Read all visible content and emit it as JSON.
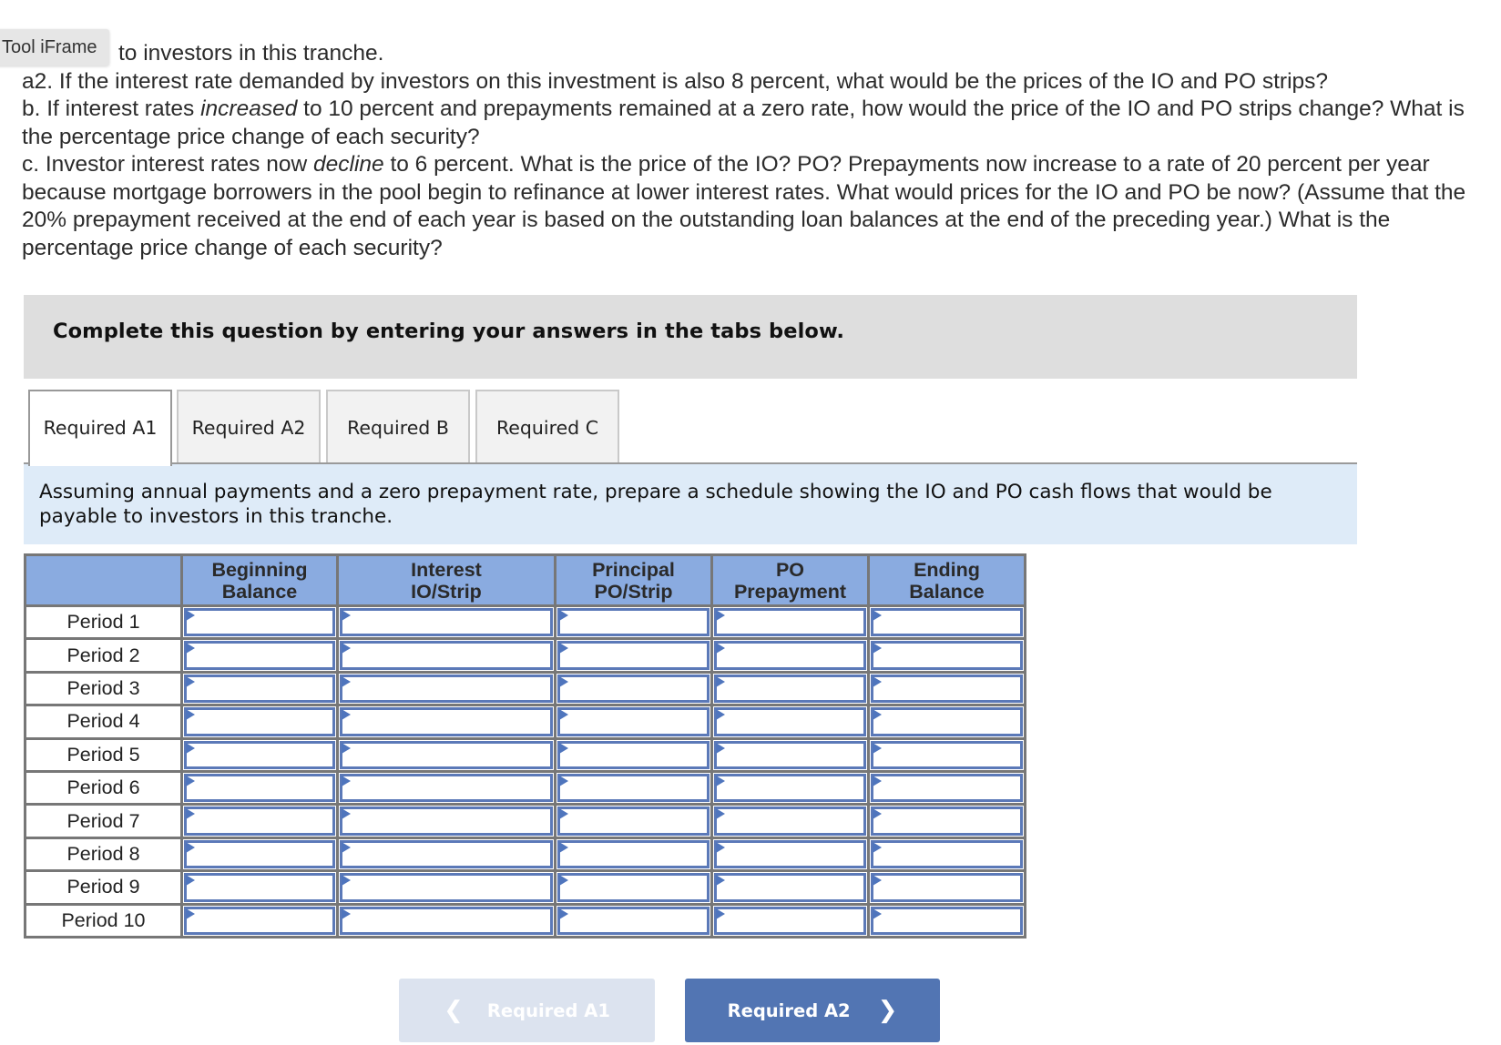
{
  "overlay_label": "Tool iFrame",
  "question": {
    "line_partial": "to investors in this tranche.",
    "a2": "a2. If the interest rate demanded by investors on this investment is also 8 percent, what would be the prices of the IO and PO strips?",
    "b_pre": "b. If interest rates ",
    "b_em": "increased",
    "b_post": " to 10 percent and prepayments remained at a zero rate, how would the price of the IO and PO strips change? What is the percentage price change of each security?",
    "c_pre": "c. Investor interest rates now ",
    "c_em": "decline",
    "c_post": " to 6 percent. What is the price of the IO? PO? Prepayments now increase to a rate of 20 percent per year because mortgage borrowers in the pool begin to refinance at lower interest rates. What would prices for the IO and PO be now? (Assume that the 20% prepayment received at the end of each year is based on the outstanding loan balances at the end of the preceding year.) What is the percentage price change of each security?"
  },
  "instruction": "Complete this question by entering your answers in the tabs below.",
  "tabs": [
    {
      "label": "Required A1",
      "active": true
    },
    {
      "label": "Required A2",
      "active": false
    },
    {
      "label": "Required B",
      "active": false
    },
    {
      "label": "Required C",
      "active": false
    }
  ],
  "prompt": "Assuming annual payments and a zero prepayment rate, prepare a schedule showing the IO and PO cash flows that would be payable to investors in this tranche.",
  "table": {
    "headers": [
      "",
      "Beginning\nBalance",
      "Interest\nIO/Strip",
      "Principal\nPO/Strip",
      "PO\nPrepayment",
      "Ending\nBalance"
    ],
    "rows": [
      {
        "label": "Period 1",
        "values": [
          "",
          "",
          "",
          "",
          ""
        ]
      },
      {
        "label": "Period 2",
        "values": [
          "",
          "",
          "",
          "",
          ""
        ]
      },
      {
        "label": "Period 3",
        "values": [
          "",
          "",
          "",
          "",
          ""
        ]
      },
      {
        "label": "Period 4",
        "values": [
          "",
          "",
          "",
          "",
          ""
        ]
      },
      {
        "label": "Period 5",
        "values": [
          "",
          "",
          "",
          "",
          ""
        ]
      },
      {
        "label": "Period 6",
        "values": [
          "",
          "",
          "",
          "",
          ""
        ]
      },
      {
        "label": "Period 7",
        "values": [
          "",
          "",
          "",
          "",
          ""
        ]
      },
      {
        "label": "Period 8",
        "values": [
          "",
          "",
          "",
          "",
          ""
        ]
      },
      {
        "label": "Period 9",
        "values": [
          "",
          "",
          "",
          "",
          ""
        ]
      },
      {
        "label": "Period 10",
        "values": [
          "",
          "",
          "",
          "",
          ""
        ]
      }
    ]
  },
  "nav": {
    "prev_label": "Required A1",
    "prev_icon": "chevron-left-icon",
    "next_label": "Required A2",
    "next_icon": "chevron-right-icon"
  },
  "colors": {
    "header_fill": "#8aabe0",
    "input_border": "#5b79b8",
    "next_button": "#5275b3",
    "prev_button_disabled": "#dce3ef",
    "prompt_bg": "#deebf8",
    "instruction_bg": "#dedede"
  }
}
